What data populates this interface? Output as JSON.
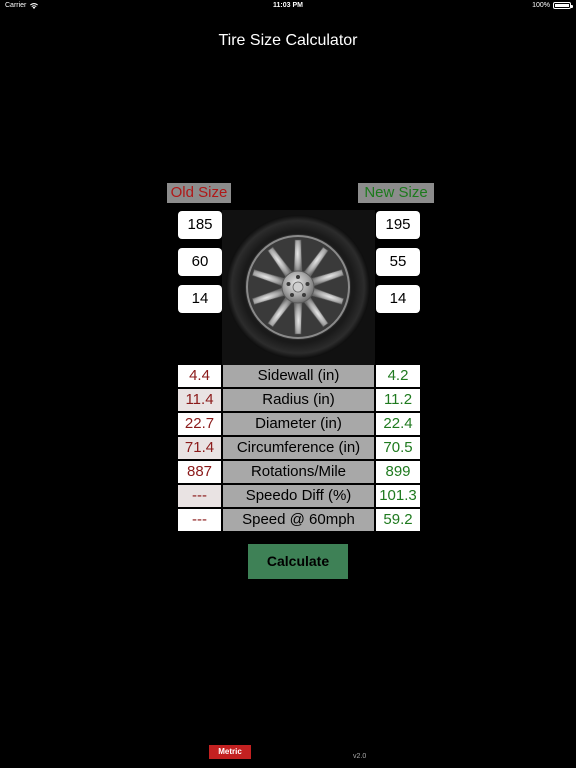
{
  "status_bar": {
    "carrier": "Carrier",
    "time": "11:03 PM",
    "battery": "100%"
  },
  "title": "Tire Size Calculator",
  "old_size": {
    "header": "Old Size",
    "width": "185",
    "aspect": "60",
    "rim": "14"
  },
  "new_size": {
    "header": "New Size",
    "width": "195",
    "aspect": "55",
    "rim": "14"
  },
  "results": [
    {
      "old": "4.4",
      "label": "Sidewall (in)",
      "new": "4.2"
    },
    {
      "old": "11.4",
      "label": "Radius (in)",
      "new": "11.2"
    },
    {
      "old": "22.7",
      "label": "Diameter (in)",
      "new": "22.4"
    },
    {
      "old": "71.4",
      "label": "Circumference (in)",
      "new": "70.5"
    },
    {
      "old": "887",
      "label": "Rotations/Mile",
      "new": "899"
    },
    {
      "old": "---",
      "label": "Speedo Diff (%)",
      "new": "101.3"
    },
    {
      "old": "---",
      "label": "Speed @ 60mph",
      "new": "59.2"
    }
  ],
  "calculate_label": "Calculate",
  "metric_label": "Metric",
  "version": "v2.0",
  "colors": {
    "old_accent": "#b01818",
    "new_accent": "#1c7a1c",
    "button_green": "#3e8156",
    "metric_red": "#c32121"
  }
}
